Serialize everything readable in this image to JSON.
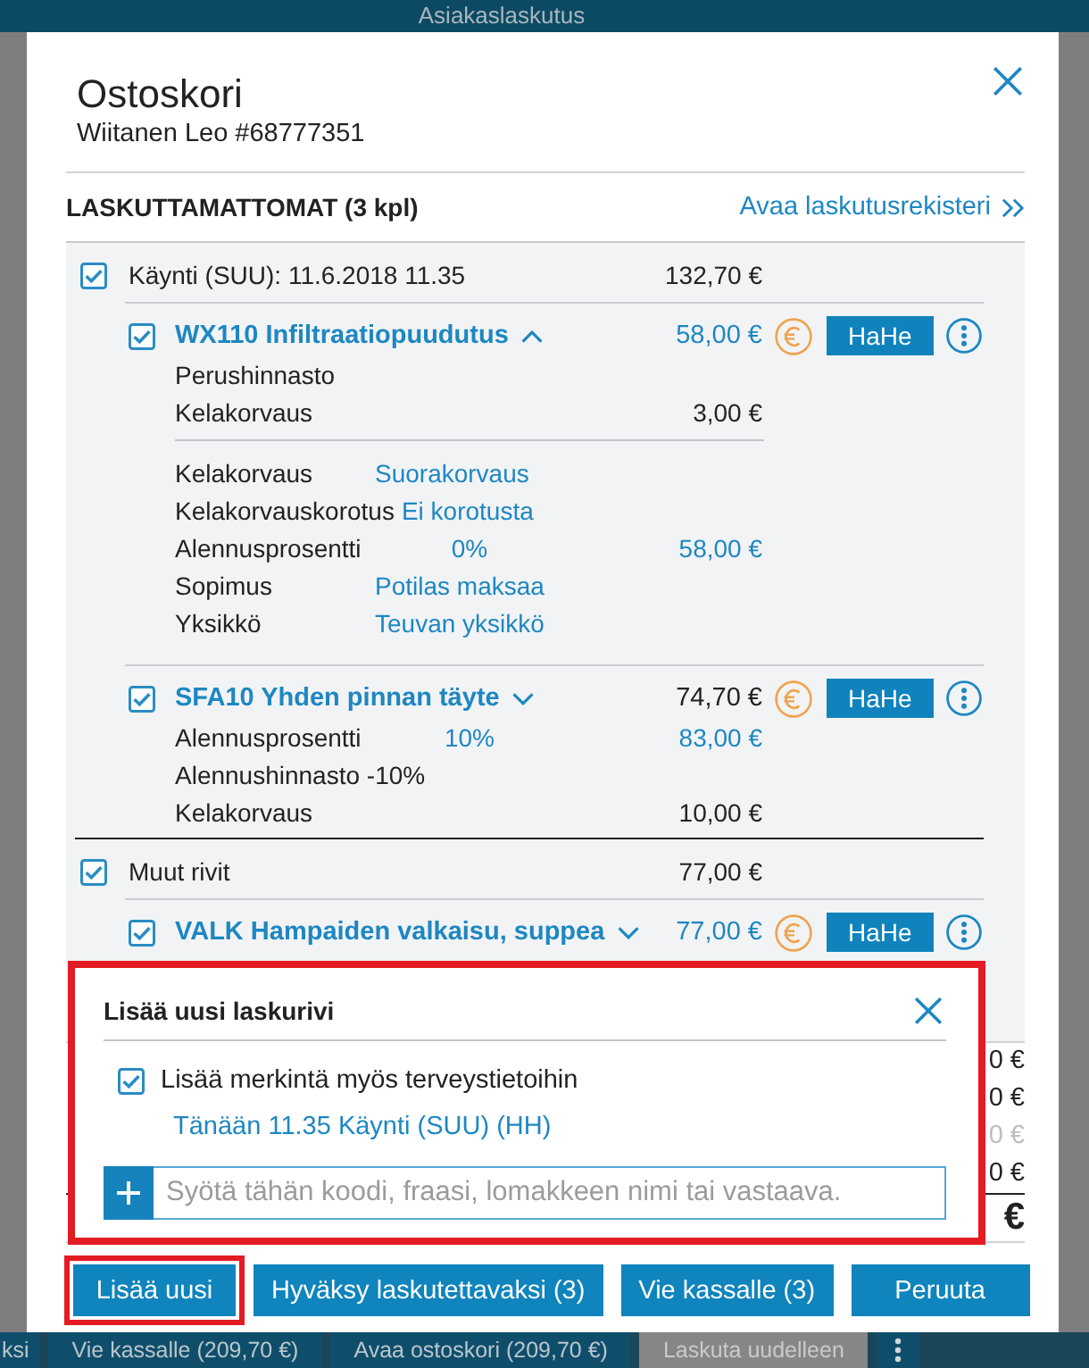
{
  "app": {
    "title": "Asiakaslaskutus",
    "footer_buttons": [
      {
        "label": "ksi",
        "kind": "primary"
      },
      {
        "label": "Vie kassalle (209,70 €)",
        "kind": "primary"
      },
      {
        "label": "Avaa ostoskori (209,70 €)",
        "kind": "primary"
      },
      {
        "label": "Laskuta uudelleen",
        "kind": "secondary"
      },
      {
        "kind": "more"
      }
    ]
  },
  "dialog": {
    "title": "Ostoskori",
    "subtitle": "Wiitanen Leo #68777351",
    "section": {
      "heading": "LASKUTTAMATTOMAT (3 kpl)",
      "link": "Avaa laskutusrekisteri"
    },
    "groups": [
      {
        "label": "Käynti (SUU): 11.6.2018 11.35",
        "amount": "132,70 €",
        "checked": true,
        "items": [
          {
            "name": "WX110 Infiltraatiopuudutus",
            "checked": true,
            "expanded": true,
            "price": "58,00 €",
            "price_editable": true,
            "action_button": "HaHe",
            "rows": [
              {
                "kind": "text",
                "label": "Perushinnasto"
              },
              {
                "kind": "text",
                "label": "Kelakorvaus",
                "amount": "3,00 €",
                "amount_editable": false
              }
            ],
            "details": [
              {
                "kind": "setting",
                "label": "Kelakorvaus",
                "value": "Suorakorvaus"
              },
              {
                "kind": "setting",
                "label": "Kelakorvauskorotus",
                "value": "Ei korotusta"
              },
              {
                "kind": "percent",
                "label": "Alennusprosentti",
                "value": "0%",
                "amount": "58,00 €",
                "amount_editable": true
              },
              {
                "kind": "setting",
                "label": "Sopimus",
                "value": "Potilas maksaa"
              },
              {
                "kind": "setting",
                "label": "Yksikkö",
                "value": "Teuvan yksikkö"
              }
            ]
          },
          {
            "name": "SFA10 Yhden pinnan täyte",
            "checked": true,
            "expanded": false,
            "price": "74,70 €",
            "price_editable": false,
            "action_button": "HaHe",
            "rows": [
              {
                "kind": "percent",
                "label": "Alennusprosentti",
                "value": "10%",
                "amount": "83,00 €",
                "amount_editable": true
              },
              {
                "kind": "text",
                "label": "Alennushinnasto -10%"
              },
              {
                "kind": "text",
                "label": "Kelakorvaus",
                "amount": "10,00 €",
                "amount_editable": false
              }
            ]
          }
        ]
      },
      {
        "label": "Muut rivit",
        "amount": "77,00 €",
        "checked": true,
        "items": [
          {
            "name": "VALK Hampaiden valkaisu, suppea",
            "checked": true,
            "expanded": false,
            "price": "77,00 €",
            "price_editable": true,
            "action_button": "HaHe"
          }
        ]
      }
    ],
    "summary_amounts": [
      {
        "text": "0 €",
        "kind": "normal"
      },
      {
        "text": "0 €",
        "kind": "normal"
      },
      {
        "text": "0 €",
        "kind": "muted"
      },
      {
        "text": "0 €",
        "kind": "normal"
      },
      {
        "text": "€",
        "kind": "total"
      }
    ],
    "popup": {
      "title": "Lisää uusi laskurivi",
      "highlighted": true,
      "add_to_health_record": {
        "label": "Lisää merkintä myös terveystietoihin",
        "checked": true
      },
      "visit_link": "Tänään 11.35 Käynti (SUU) (HH)",
      "input": {
        "placeholder": "Syötä tähän koodi, fraasi, lomakkeen nimi tai vastaava."
      }
    },
    "buttons": [
      {
        "label": "Lisää uusi",
        "highlighted": true
      },
      {
        "label": "Hyväksy laskutettavaksi (3)",
        "highlighted": false
      },
      {
        "label": "Vie kassalle (3)",
        "highlighted": false
      },
      {
        "label": "Peruuta",
        "highlighted": false
      }
    ]
  }
}
